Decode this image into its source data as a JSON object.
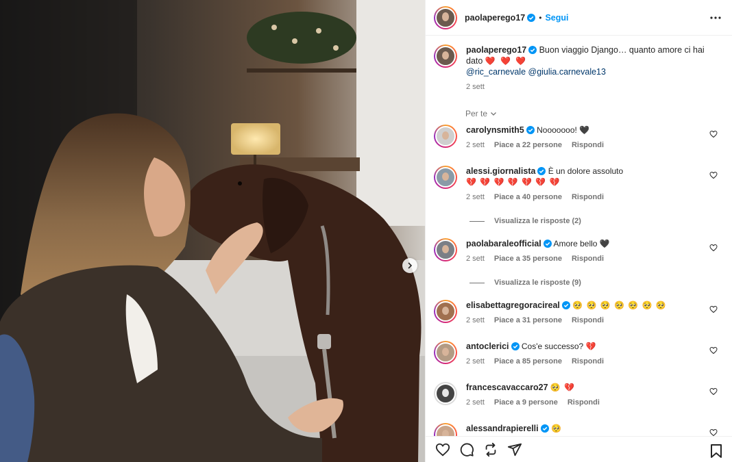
{
  "post": {
    "author": "paolaperego17",
    "follow_label": "Segui",
    "separator": "•",
    "caption_text": "Buon viaggio Django… quanto amore ci hai dato",
    "caption_hearts": "❤️ ❤️ ❤️",
    "mentions": "@ric_carnevale @giulia.carnevale13",
    "caption_time": "2 sett",
    "sort_label": "Per te"
  },
  "comments": [
    {
      "user": "carolynsmith5",
      "text": "Nooooooo!",
      "emoji": "🖤",
      "time": "2 sett",
      "likes": "Piace a 22 persone",
      "reply": "Rispondi"
    },
    {
      "user": "alessi.giornalista",
      "text": "È un dolore assoluto",
      "emoji": "💔 💔 💔 💔 💔 💔 💔",
      "time": "2 sett",
      "likes": "Piace a 40 persone",
      "reply": "Rispondi",
      "view_replies": "Visualizza le risposte (2)"
    },
    {
      "user": "paolabaraleofficial",
      "text": "Amore bello",
      "emoji": "🖤",
      "time": "2 sett",
      "likes": "Piace a 35 persone",
      "reply": "Rispondi",
      "view_replies": "Visualizza le risposte (9)"
    },
    {
      "user": "elisabettagregoracireal",
      "text": "",
      "emoji": "🥺 🥺 🥺 🥺 🥺 🥺 🥺",
      "time": "2 sett",
      "likes": "Piace a 31 persone",
      "reply": "Rispondi"
    },
    {
      "user": "antoclerici",
      "text": "Cos'e successo?",
      "emoji": "💔",
      "time": "2 sett",
      "likes": "Piace a 85 persone",
      "reply": "Rispondi"
    },
    {
      "user": "francescavaccaro27",
      "text": "",
      "emoji": "🥺 💔",
      "time": "2 sett",
      "likes": "Piace a 9 persone",
      "reply": "Rispondi"
    },
    {
      "user": "alessandrapierelli",
      "text": "",
      "emoji": "🥺",
      "time": "",
      "likes": "",
      "reply": ""
    }
  ],
  "colors": {
    "link": "#0095f6",
    "mention": "#00376b",
    "verified": "#0095f6",
    "muted": "#737373"
  },
  "icons": [
    "heart-icon",
    "comment-icon",
    "share-icon",
    "send-icon",
    "bookmark-icon",
    "more-icon",
    "chevron-right-icon",
    "verified-icon"
  ]
}
